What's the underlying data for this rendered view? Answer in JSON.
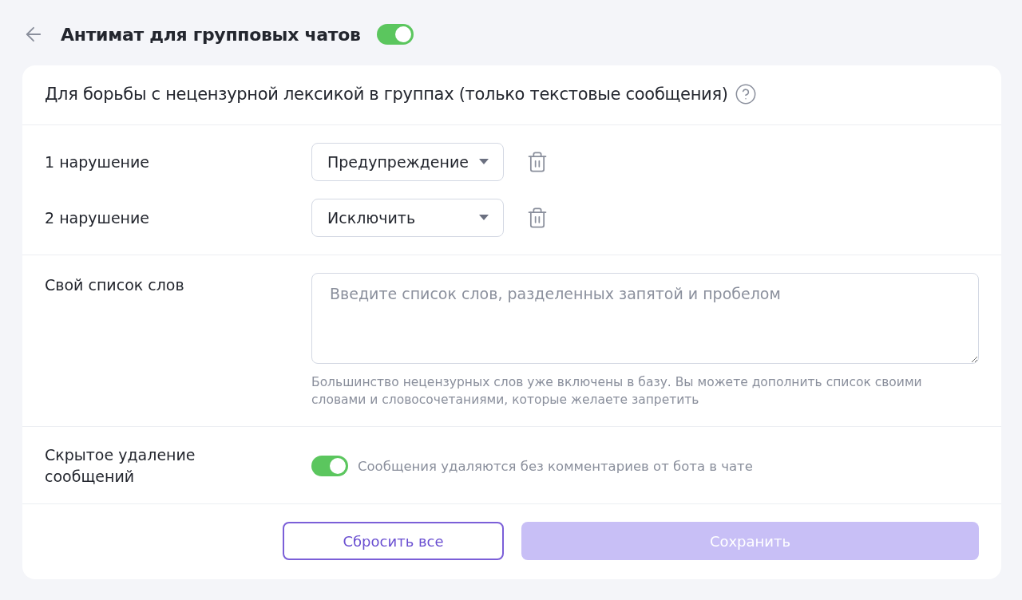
{
  "header": {
    "title": "Антимат для групповых чатов",
    "on": true
  },
  "card": {
    "description": "Для борьбы с нецензурной лексикой в группах (только текстовые сообщения)"
  },
  "violations": [
    {
      "label": "1 нарушение",
      "action": "Предупреждение"
    },
    {
      "label": "2 нарушение",
      "action": "Исключить"
    }
  ],
  "word_list": {
    "label": "Свой список слов",
    "placeholder": "Введите список слов, разделенных запятой и пробелом",
    "hint": "Большинство нецензурных слов уже включены в базу. Вы можете дополнить список своими словами и словосочетаниями, которые желаете запретить"
  },
  "hidden_delete": {
    "label": "Скрытое удаление сообщений",
    "on": true,
    "description": "Сообщения удаляются без комментариев от бота в чате"
  },
  "buttons": [
    {
      "label": "Сбросить все",
      "kind": "outline",
      "disabled": false
    },
    {
      "label": "Сохранить",
      "kind": "primary",
      "disabled": true
    }
  ]
}
